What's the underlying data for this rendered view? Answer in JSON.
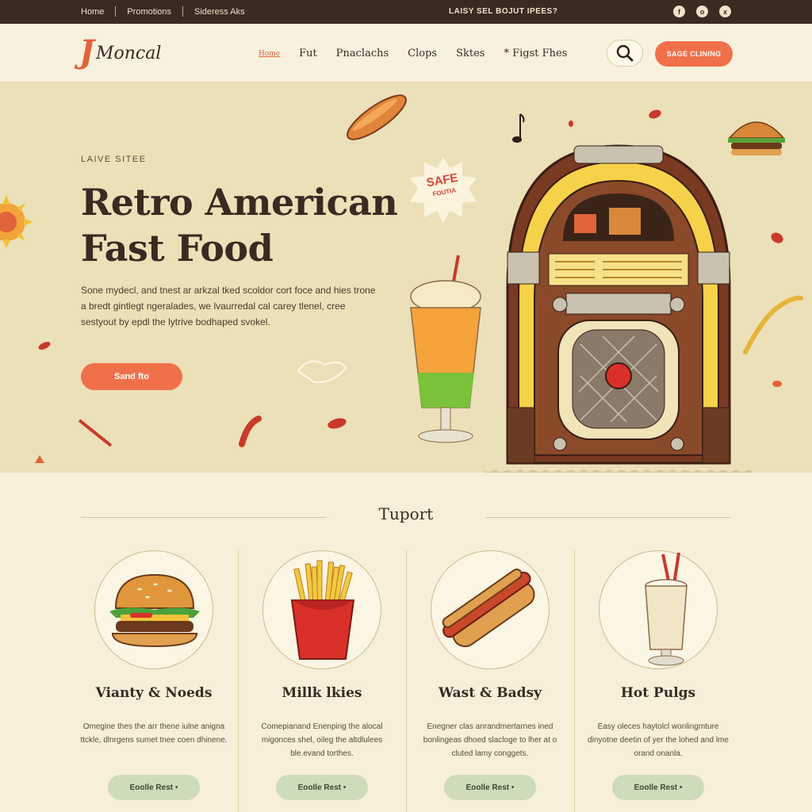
{
  "topbar": {
    "links": [
      "Home",
      "Promotions",
      "Sideress Aks"
    ],
    "promo": "LAISY SEL BOJUT IPEES?",
    "social": [
      "f",
      "o",
      "x"
    ]
  },
  "header": {
    "logo_initial": "J",
    "logo_word": "Moncal",
    "nav": [
      "Home",
      "Fut",
      "Pnaclachs",
      "Clops",
      "Sktes",
      "* Figst Fhes"
    ],
    "cta": "SAGE CLINING"
  },
  "hero": {
    "eyebrow": "LAIVE SITEE",
    "title_line1": "Retro American",
    "title_line2": "Fast Food",
    "description": "Sone mydecl, and tnest ar arkzal tked scoldor cort foce and hies trone a bredt gintlegt ngeralades, we lvaurredal cal carey tlenel, cree sestyout by epdl the lytrive bodhaped svokel.",
    "button": "Sand fto",
    "badge_main": "SAFE",
    "badge_sub": "FOUTIA"
  },
  "section": {
    "title": "Tuport"
  },
  "cards": [
    {
      "name": "Vianty & Noeds",
      "text": "Omegine thes the arr thene iulne anigna ttckle, dlnrgens sumet tnee coen dhinene.",
      "button": "Eoolle Rest •",
      "icon": "burger-icon"
    },
    {
      "name": "Millk lkies",
      "text": "Comepianand Enenping the alocal migonces shel, oileg the altdlulees ble.evand torthes.",
      "button": "Eoolle Rest •",
      "icon": "fries-icon"
    },
    {
      "name": "Wast & Badsy",
      "text": "Enegner clas anrandmertarnes ined bonlingeas dhoed slacloge to lher at o cluted lamy conggets.",
      "button": "Eoolle Rest •",
      "icon": "hotdog-icon"
    },
    {
      "name": "Hot Pulgs",
      "text": "Easy oleces haytolcl wonlingmture dinyotne deetin of yer the lohed and lme orand onanla.",
      "button": "Eoolle Rest •",
      "icon": "milkshake-icon"
    }
  ],
  "colors": {
    "accent": "#f0704a",
    "dark": "#3a2a22",
    "cream": "#f7efd9",
    "hero_bg": "#ece0b8",
    "sage": "#cfdcbb"
  }
}
